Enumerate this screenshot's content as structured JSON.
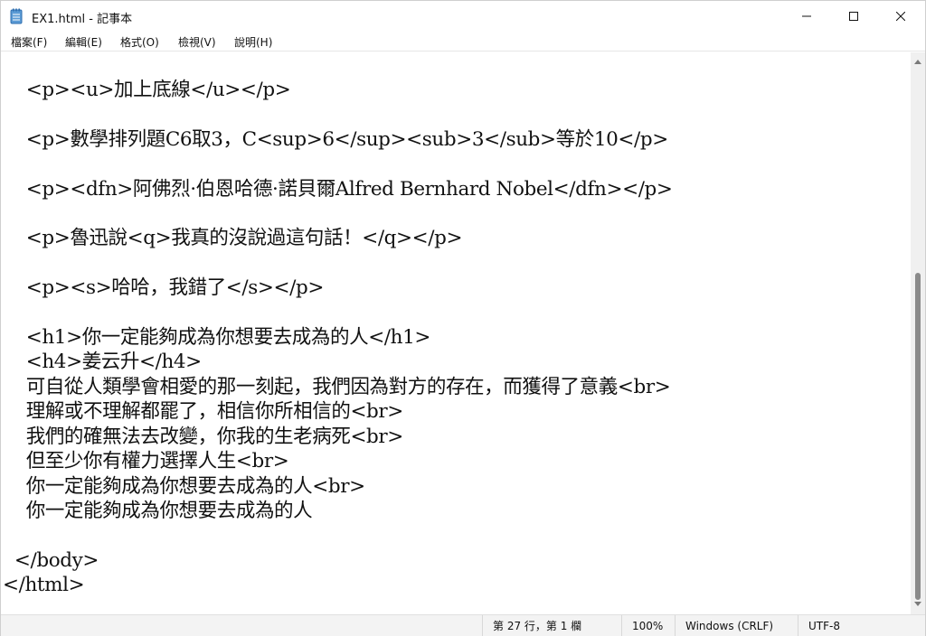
{
  "window": {
    "title": "EX1.html - 記事本",
    "icon": "notepad-icon"
  },
  "menu": {
    "items": [
      "檔案(F)",
      "編輯(E)",
      "格式(O)",
      "檢視(V)",
      "說明(H)"
    ]
  },
  "editor": {
    "lines": [
      "    <p><u>加上底線</u></p>",
      "",
      "    <p>數學排列題C6取3，C<sup>6</sup><sub>3</sub>等於10</p>",
      "",
      "    <p><dfn>阿佛烈·伯恩哈德·諾貝爾Alfred Bernhard Nobel</dfn></p>",
      "",
      "    <p>魯迅說<q>我真的沒說過這句話！</q></p>",
      "",
      "    <p><s>哈哈，我錯了</s></p>",
      "",
      "    <h1>你一定能夠成為你想要去成為的人</h1>",
      "    <h4>姜云升</h4>",
      "    可自從人類學會相愛的那一刻起，我們因為對方的存在，而獲得了意義<br>",
      "    理解或不理解都罷了，相信你所相信的<br>",
      "    我們的確無法去改變，你我的生老病死<br>",
      "    但至少你有權力選擇人生<br>",
      "    你一定能夠成為你想要去成為的人<br>",
      "    你一定能夠成為你想要去成為的人",
      "",
      "  </body>",
      "</html>"
    ]
  },
  "status": {
    "position": "第 27 行，第 1 欄",
    "zoom": "100%",
    "line_ending": "Windows (CRLF)",
    "encoding": "UTF-8"
  },
  "colors": {
    "accent": "#3c78c8",
    "text": "#111111",
    "background": "#ffffff"
  }
}
